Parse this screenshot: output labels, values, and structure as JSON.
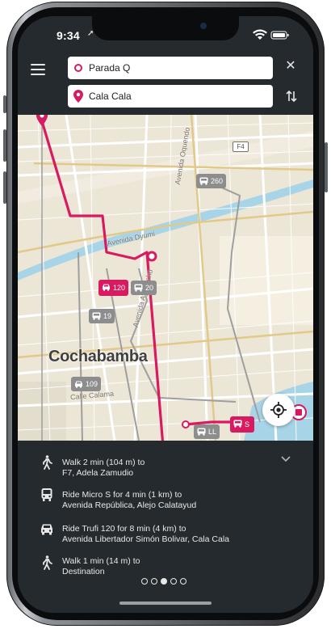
{
  "status_bar": {
    "time": "9:34"
  },
  "search": {
    "from_value": "Parada Q",
    "to_value": "Cala Cala"
  },
  "map": {
    "city_label": "Cochabamba",
    "street_labels": [
      "Avenida Oquendo",
      "Avenida Dyumi",
      "Calle Calama",
      "Avenida Ayacucho"
    ],
    "road_sign": "F4",
    "stop_badges": [
      {
        "label": "260",
        "style": "gray",
        "icon": "bus-icon"
      },
      {
        "label": "120",
        "style": "pink",
        "icon": "taxi-icon"
      },
      {
        "label": "20",
        "style": "gray",
        "icon": "bus-icon"
      },
      {
        "label": "19",
        "style": "gray",
        "icon": "bus-icon"
      },
      {
        "label": "109",
        "style": "gray",
        "icon": "taxi-icon"
      },
      {
        "label": "LL",
        "style": "gray",
        "icon": "bus-icon"
      },
      {
        "label": "S",
        "style": "pink",
        "icon": "bus-icon"
      }
    ],
    "route_color": "#d81b60"
  },
  "steps": [
    {
      "icon": "walk-icon",
      "line1": "Walk 2 min (104 m) to",
      "line2": "F7, Adela Zamudio"
    },
    {
      "icon": "bus-icon",
      "line1": "Ride Micro S for 4 min (1 km) to",
      "line2": "Avenida República, Alejo Calatayud"
    },
    {
      "icon": "taxi-icon",
      "line1": "Ride Trufi 120 for 8 min (4 km) to",
      "line2": "Avenida Libertador Simón Bolivar, Cala Cala"
    },
    {
      "icon": "walk-icon",
      "line1": "Walk 1 min (14 m) to",
      "line2": "Destination"
    }
  ],
  "pagination": {
    "total": 5,
    "active_index": 2
  },
  "colors": {
    "accent": "#d81b60",
    "panel_bg": "#252a2e",
    "map_bg": "#ece6d7"
  }
}
